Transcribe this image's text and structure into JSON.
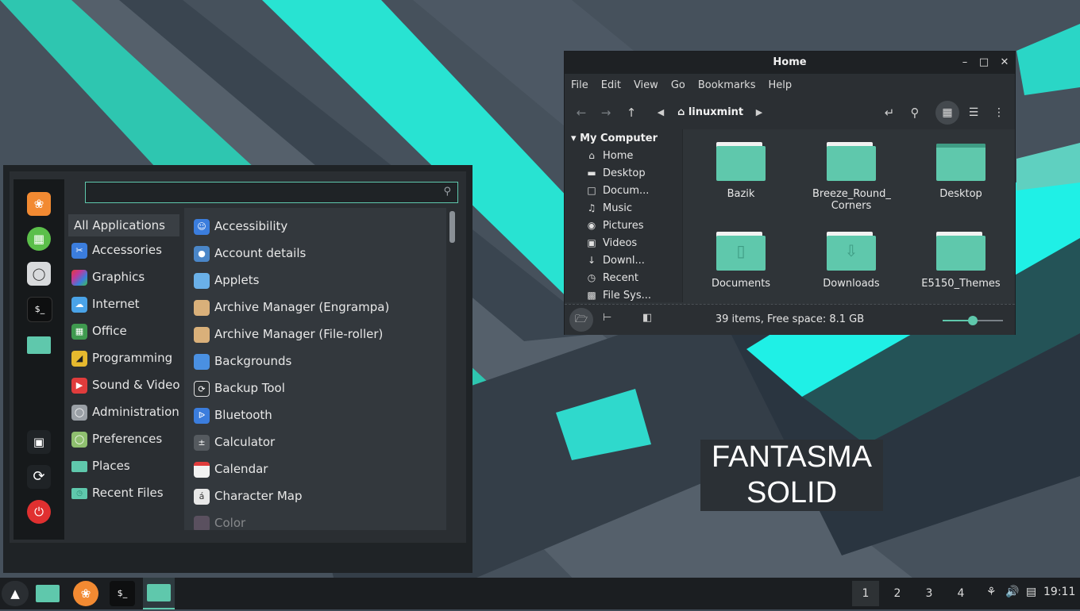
{
  "desktop": {
    "label_line1": "FANTASMA",
    "label_line2": "SOLID"
  },
  "file_manager": {
    "title": "Home",
    "menu": [
      "File",
      "Edit",
      "View",
      "Go",
      "Bookmarks",
      "Help"
    ],
    "breadcrumb": "linuxmint",
    "sidebar_header": "My Computer",
    "sidebar_items": [
      {
        "label": "Home",
        "icon": "home-icon"
      },
      {
        "label": "Desktop",
        "icon": "desktop-icon"
      },
      {
        "label": "Docum...",
        "icon": "document-icon"
      },
      {
        "label": "Music",
        "icon": "music-icon"
      },
      {
        "label": "Pictures",
        "icon": "camera-icon"
      },
      {
        "label": "Videos",
        "icon": "video-icon"
      },
      {
        "label": "Downl...",
        "icon": "download-icon"
      },
      {
        "label": "Recent",
        "icon": "clock-icon"
      },
      {
        "label": "File Sys...",
        "icon": "drive-icon"
      }
    ],
    "files": [
      {
        "name": "Bazik"
      },
      {
        "name": "Breeze_Round_ Corners"
      },
      {
        "name": "Desktop"
      },
      {
        "name": "Documents"
      },
      {
        "name": "Downloads"
      },
      {
        "name": "E5150_Themes"
      }
    ],
    "status": "39 items, Free space: 8.1 GB",
    "zoom_level": 0.5
  },
  "app_menu": {
    "search_placeholder": "",
    "categories": [
      {
        "label": "All Applications",
        "color": "#3a3f44"
      },
      {
        "label": "Accessories",
        "color": "#3b7ddd"
      },
      {
        "label": "Graphics",
        "color": "#c0399a"
      },
      {
        "label": "Internet",
        "color": "#4aa3e8"
      },
      {
        "label": "Office",
        "color": "#3f9a4f"
      },
      {
        "label": "Programming",
        "color": "#e6b92e"
      },
      {
        "label": "Sound & Video",
        "color": "#e03c3c"
      },
      {
        "label": "Administration",
        "color": "#9aa0a6"
      },
      {
        "label": "Preferences",
        "color": "#8fbf6f"
      },
      {
        "label": "Places",
        "color": "#5fc8ac"
      },
      {
        "label": "Recent Files",
        "color": "#5fc8ac"
      }
    ],
    "applications": [
      {
        "label": "Accessibility",
        "color": "#3b7ddd"
      },
      {
        "label": "Account details",
        "color": "#4a86c8"
      },
      {
        "label": "Applets",
        "color": "#6ab0e8"
      },
      {
        "label": "Archive Manager (Engrampa)",
        "color": "#d9b07a"
      },
      {
        "label": "Archive Manager (File-roller)",
        "color": "#d9b07a"
      },
      {
        "label": "Backgrounds",
        "color": "#4a90e2"
      },
      {
        "label": "Backup Tool",
        "color": "#2d3134"
      },
      {
        "label": "Bluetooth",
        "color": "#3b7ddd"
      },
      {
        "label": "Calculator",
        "color": "#555a5f"
      },
      {
        "label": "Calendar",
        "color": "#f2f2f2"
      },
      {
        "label": "Character Map",
        "color": "#e8e8e8"
      },
      {
        "label": "Color",
        "color": "#8a6f8a"
      }
    ]
  },
  "taskbar": {
    "workspaces": [
      "1",
      "2",
      "3",
      "4"
    ],
    "clock": "19:11"
  }
}
